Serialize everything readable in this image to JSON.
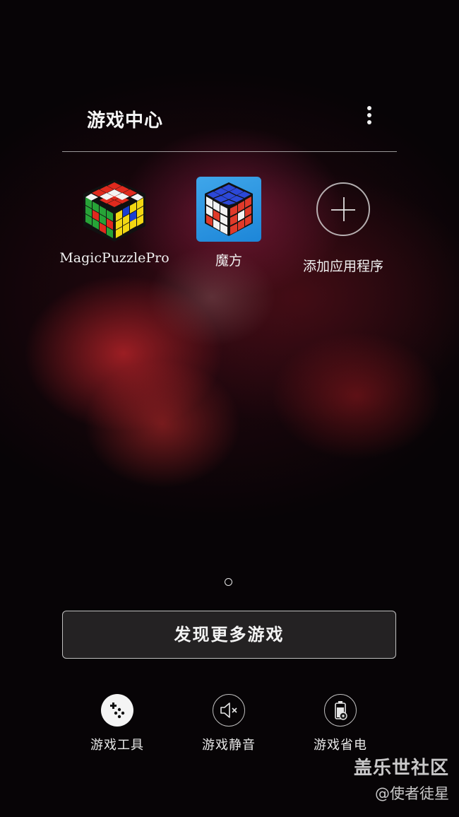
{
  "header": {
    "title": "游戏中心",
    "more_icon": "more-vertical-icon"
  },
  "apps": [
    {
      "label": "MagicPuzzlePro",
      "icon": "rubiks-cube-4x4-icon"
    },
    {
      "label": "魔方",
      "icon": "rubiks-cube-3x3-icon"
    },
    {
      "label": "添加应用程序",
      "icon": "add-circle-icon"
    }
  ],
  "pager": {
    "current": 1,
    "total": 1
  },
  "discover_button": {
    "label": "发现更多游戏"
  },
  "tools": [
    {
      "label": "游戏工具",
      "icon": "gamepad-icon"
    },
    {
      "label": "游戏静音",
      "icon": "mute-icon"
    },
    {
      "label": "游戏省电",
      "icon": "battery-saver-icon"
    }
  ],
  "watermark": {
    "brand": "盖乐世社区",
    "user": "@使者徒星"
  }
}
